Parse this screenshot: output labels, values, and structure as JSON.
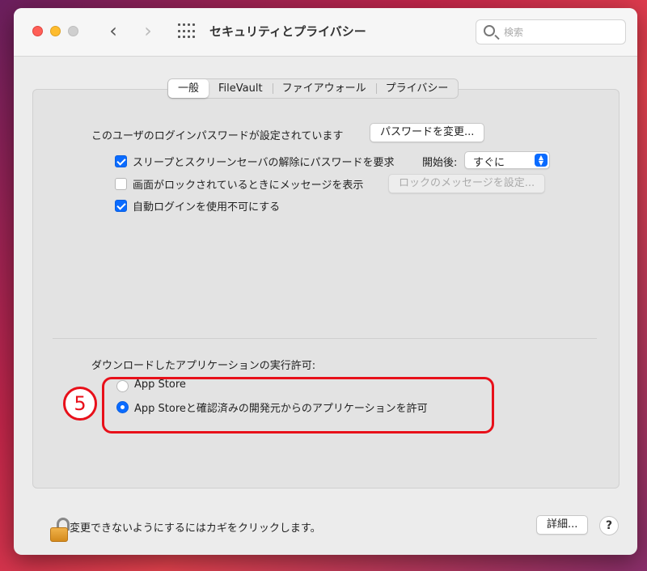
{
  "window": {
    "title": "セキュリティとプライバシー",
    "search_placeholder": "検索"
  },
  "tabs": [
    {
      "label": "一般",
      "active": true
    },
    {
      "label": "FileVault",
      "active": false
    },
    {
      "label": "ファイアウォール",
      "active": false
    },
    {
      "label": "プライバシー",
      "active": false
    }
  ],
  "general": {
    "password_label": "このユーザのログインパスワードが設定されています",
    "change_password_button": "パスワードを変更...",
    "require_password_label": "スリープとスクリーンセーバの解除にパスワードを要求",
    "require_password_checked": true,
    "after_label": "開始後:",
    "after_value": "すぐに",
    "show_message_label": "画面がロックされているときにメッセージを表示",
    "show_message_checked": false,
    "set_lock_message_button": "ロックのメッセージを設定...",
    "disable_auto_login_label": "自動ログインを使用不可にする",
    "disable_auto_login_checked": true
  },
  "downloads": {
    "label": "ダウンロードしたアプリケーションの実行許可:",
    "option_app_store": "App Store",
    "option_identified": "App Storeと確認済みの開発元からのアプリケーションを許可",
    "selected": "identified"
  },
  "annotation": {
    "step_number": "5",
    "color": "#e8101a"
  },
  "footer": {
    "lock_text": "変更できないようにするにはカギをクリックします。",
    "advanced_button": "詳細...",
    "help_label": "?"
  },
  "colors": {
    "accent": "#0a6bff",
    "close": "#ff5f57",
    "minimize": "#febc2e"
  }
}
